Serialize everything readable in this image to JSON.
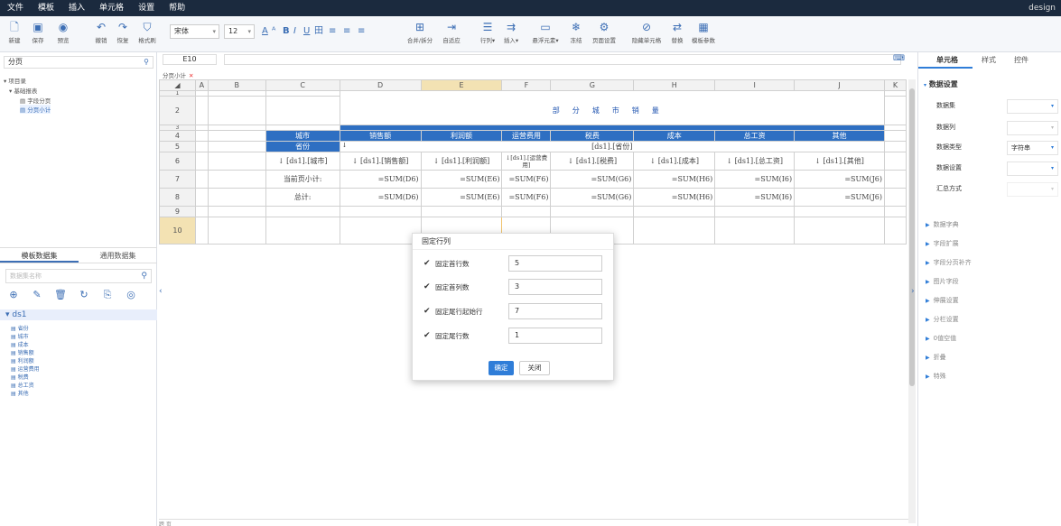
{
  "menu": [
    "文件",
    "模板",
    "插入",
    "单元格",
    "设置",
    "帮助"
  ],
  "user": "design",
  "toolbar": {
    "buttons": [
      {
        "icon": "new-icon",
        "label": "新建"
      },
      {
        "icon": "save-icon",
        "label": "保存"
      },
      {
        "icon": "preview-icon",
        "label": "预览"
      },
      {
        "icon": "undo-icon",
        "label": "撤销"
      },
      {
        "icon": "redo-icon",
        "label": "恢复"
      },
      {
        "icon": "format-painter-icon",
        "label": "格式刷"
      }
    ],
    "font": "宋体",
    "size": "12",
    "format": [
      "A",
      "ᴬ",
      "B",
      "I",
      "U",
      "田",
      "≡",
      "≡",
      "≡"
    ],
    "right_buttons": [
      {
        "icon": "merge-icon",
        "label": "合并/拆分"
      },
      {
        "icon": "auto-fit-icon",
        "label": "自适应"
      },
      {
        "icon": "row-col-icon",
        "label": "行列▾"
      },
      {
        "icon": "insert-icon",
        "label": "插入▾"
      },
      {
        "icon": "floating-icon",
        "label": "悬浮元素▾"
      },
      {
        "icon": "freeze-icon",
        "label": "冻结"
      },
      {
        "icon": "page-setup-icon",
        "label": "页面设置"
      },
      {
        "icon": "hide-cell-icon",
        "label": "隐藏单元格"
      },
      {
        "icon": "replace-icon",
        "label": "替换"
      },
      {
        "icon": "template-param-icon",
        "label": "模板参数"
      }
    ]
  },
  "left": {
    "search": "分页",
    "tree": [
      {
        "label": "▾ 项目录"
      },
      {
        "label": "▾ 基础报表"
      },
      {
        "label": "▤ 字段分页"
      },
      {
        "label": "▤ 分页小计"
      }
    ],
    "tabs": [
      "模板数据集",
      "通用数据集"
    ],
    "ds_search_placeholder": "数据集名称",
    "dataset": "▾ ds1",
    "fields": [
      "省份",
      "城市",
      "成本",
      "销售额",
      "利润额",
      "运营费用",
      "税费",
      "总工资",
      "其他"
    ]
  },
  "formula": {
    "cellref": "E10"
  },
  "sheet_tab": "分页小计",
  "grid": {
    "cols": [
      "",
      "A",
      "B",
      "C",
      "D",
      "E",
      "F",
      "G",
      "H",
      "I",
      "J",
      "K"
    ],
    "title": "部分城市销量",
    "header_row": [
      "城市",
      "销售额",
      "利润额",
      "运营费用",
      "税费",
      "成本",
      "总工资",
      "其他"
    ],
    "province": "省份",
    "province_field": "[ds1].[省份]",
    "arrow": "↓",
    "row6": [
      "[ds1].[城市]",
      "[ds1].[销售额]",
      "[ds1].[利润额]",
      "[ds1].[运营费用]",
      "[ds1].[税费]",
      "[ds1].[成本]",
      "[ds1].[总工资]",
      "[ds1].[其他]"
    ],
    "row7_label": "当前页小计:",
    "row8_label": "总计:",
    "sums": [
      "=SUM(D6)",
      "=SUM(E6)",
      "=SUM(F6)",
      "=SUM(G6)",
      "=SUM(H6)",
      "=SUM(I6)",
      "=SUM(J6)"
    ],
    "row_nums": [
      "1",
      "2",
      "3",
      "4",
      "5",
      "6",
      "7",
      "8",
      "9",
      "10"
    ]
  },
  "dialog": {
    "title": "固定行列",
    "rows": [
      {
        "label": "固定首行数",
        "value": "5"
      },
      {
        "label": "固定首列数",
        "value": "3"
      },
      {
        "label": "固定尾行起始行",
        "value": "7"
      },
      {
        "label": "固定尾行数",
        "value": "1"
      }
    ],
    "ok": "确定",
    "close": "关闭"
  },
  "right": {
    "tabs": [
      "单元格",
      "样式",
      "控件"
    ],
    "section": "数据设置",
    "props": [
      {
        "k": "数据集",
        "v": ""
      },
      {
        "k": "数据列",
        "v": ""
      },
      {
        "k": "数据类型",
        "v": "字符串"
      },
      {
        "k": "数据设置",
        "v": ""
      },
      {
        "k": "汇总方式",
        "v": ""
      }
    ],
    "collapsed": [
      "数据字典",
      "字段扩展",
      "字段分页补齐",
      "图片字段",
      "伸展设置",
      "分栏设置",
      "0值空值",
      "折叠",
      "特殊"
    ]
  },
  "bottom": {
    "tab": "跨 页"
  },
  "colors": {
    "menubar": "#1b2a3e",
    "header_blue": "#2e6fc2",
    "accent": "#2f7dd8"
  }
}
